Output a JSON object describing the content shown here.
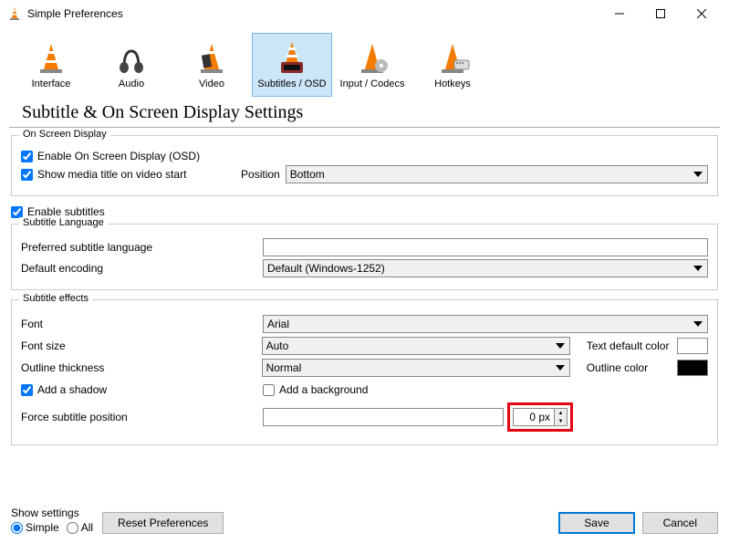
{
  "window": {
    "title": "Simple Preferences"
  },
  "categories": [
    {
      "label": "Interface"
    },
    {
      "label": "Audio"
    },
    {
      "label": "Video"
    },
    {
      "label": "Subtitles / OSD"
    },
    {
      "label": "Input / Codecs"
    },
    {
      "label": "Hotkeys"
    }
  ],
  "page": {
    "title": "Subtitle & On Screen Display Settings"
  },
  "osd": {
    "group_title": "On Screen Display",
    "enable_label": "Enable On Screen Display (OSD)",
    "show_title_label": "Show media title on video start",
    "position_label": "Position",
    "position_value": "Bottom"
  },
  "enable_subtitles_label": "Enable subtitles",
  "lang": {
    "group_title": "Subtitle Language",
    "preferred_label": "Preferred subtitle language",
    "preferred_value": "",
    "encoding_label": "Default encoding",
    "encoding_value": "Default (Windows-1252)"
  },
  "effects": {
    "group_title": "Subtitle effects",
    "font_label": "Font",
    "font_value": "Arial",
    "font_size_label": "Font size",
    "font_size_value": "Auto",
    "text_color_label": "Text default color",
    "text_color_value": "#ffffff",
    "outline_thickness_label": "Outline thickness",
    "outline_thickness_value": "Normal",
    "outline_color_label": "Outline color",
    "outline_color_value": "#000000",
    "shadow_label": "Add a shadow",
    "bg_label": "Add a background",
    "force_pos_label": "Force subtitle position",
    "force_pos_value": "0 px"
  },
  "bottom": {
    "show_settings_label": "Show settings",
    "simple_label": "Simple",
    "all_label": "All",
    "reset_label": "Reset Preferences",
    "save_label": "Save",
    "cancel_label": "Cancel"
  }
}
